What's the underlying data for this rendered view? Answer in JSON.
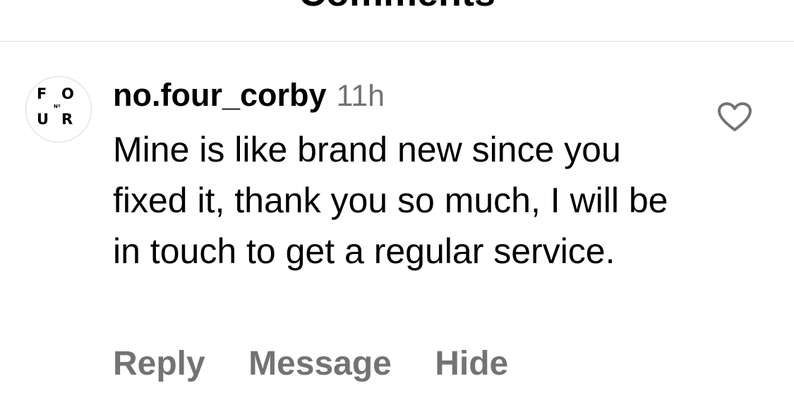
{
  "header": {
    "title": "Comments"
  },
  "comment": {
    "avatar_letters": [
      "F",
      "O",
      "U",
      "R"
    ],
    "avatar_mark": "Nº",
    "username": "no.four_corby",
    "time": "11h",
    "text": "Mine is like brand new since you fixed it, thank you so much, I will be in touch to get a regular service.",
    "actions": {
      "reply": "Reply",
      "message": "Message",
      "hide": "Hide"
    },
    "like_icon": "heart-outline-icon"
  },
  "colors": {
    "secondary_text": "#737373",
    "divider": "#e3e3e3"
  }
}
